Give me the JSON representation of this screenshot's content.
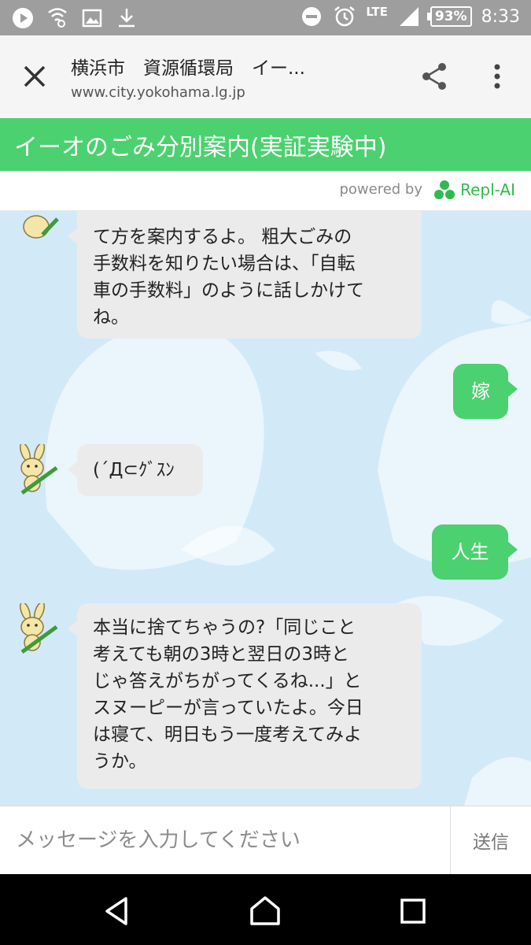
{
  "status_bar": {
    "network": "LTE",
    "battery": "93%",
    "time": "8:33"
  },
  "browser": {
    "title": "横浜市　資源循環局　イー...",
    "url": "www.city.yokohama.lg.jp"
  },
  "app": {
    "title": "イーオのごみ分別案内(実証実験中)",
    "powered_by": "powered by",
    "provider": "Repl-AI",
    "accent": "#4bd16f"
  },
  "messages": [
    {
      "from": "bot",
      "text": "て方を案内するよ。 粗大ごみの\n手数料を知りたい場合は、「自転\n車の手数料」のように話しかけて\nね。"
    },
    {
      "from": "user",
      "text": "嫁"
    },
    {
      "from": "bot",
      "text": "(´Д⊂ｸﾞｽﾝ"
    },
    {
      "from": "user",
      "text": "人生"
    },
    {
      "from": "bot",
      "text": "本当に捨てちゃうの?「同じこと\n考えても朝の3時と翌日の3時と\nじゃ答えがちがってくるね...」と\nスヌーピーが言っていたよ。今日\nは寝て、明日もう一度考えてみよ\nうか。"
    }
  ],
  "input": {
    "placeholder": "メッセージを入力してください",
    "value": "",
    "send_label": "送信"
  },
  "icons": [
    "play-icon",
    "wifi-settings-icon",
    "image-icon",
    "download-icon",
    "do-not-disturb-icon",
    "alarm-icon",
    "signal-icon",
    "close-icon",
    "share-icon",
    "more-vert-icon",
    "back-icon",
    "home-icon",
    "recents-icon"
  ]
}
